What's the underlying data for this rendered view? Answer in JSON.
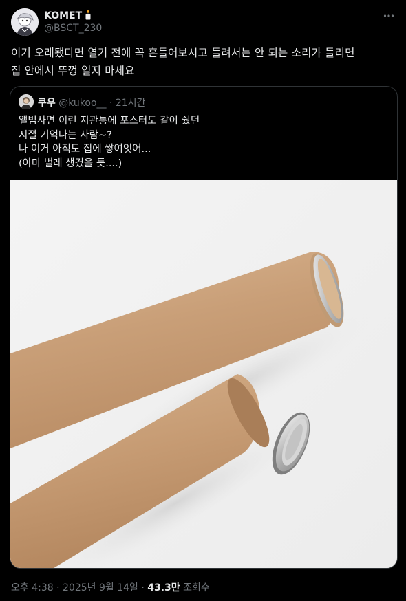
{
  "author": {
    "display_name": "KOMET",
    "badge_icon": "candle-emoji-icon",
    "handle": "@BSCT_230"
  },
  "tweet": {
    "text_lines": [
      "이거 오래됐다면 열기 전에 꼭 흔들어보시고 들려서는 안 되는 소리가 들리면",
      "집 안에서 뚜껑 열지 마세요"
    ]
  },
  "quoted_tweet": {
    "author_name": "쿠우",
    "author_handle": "@kukoo__",
    "separator": "·",
    "time": "21시간",
    "text_lines": [
      "앨범사면 이런 지관통에 포스터도 같이 줬던",
      "시절 기억나는 사람~?",
      "나 이거 아직도 집에 쌓여잇어...",
      "(아마 벌레 생겼을 듯....)"
    ]
  },
  "meta": {
    "timestamp": "오후 4:38 · 2025년 9월 14일 ·",
    "views_count": "43.3만",
    "views_label": "조회수"
  },
  "colors": {
    "background": "#000000",
    "text_primary": "#e7e9ea",
    "text_secondary": "#71767b",
    "border": "#2f3336",
    "tube_kraft": "#c9a27c"
  }
}
